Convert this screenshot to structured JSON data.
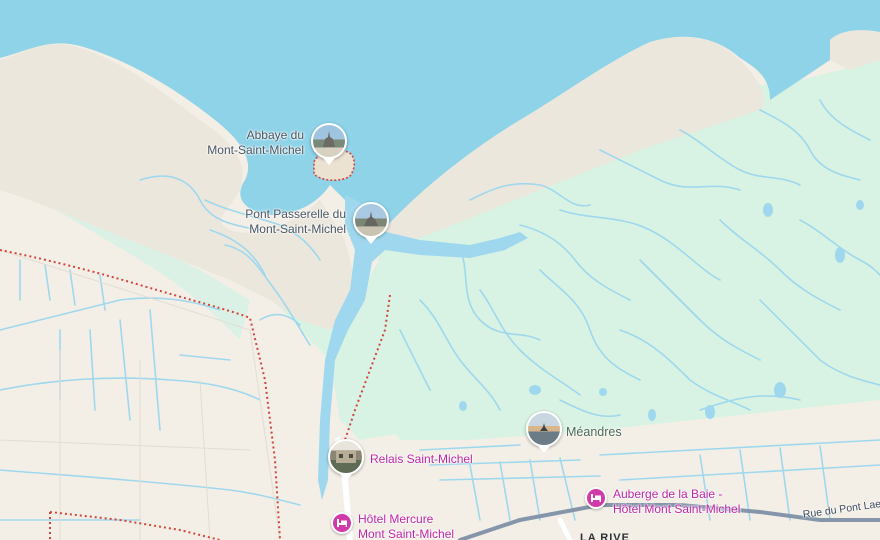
{
  "map": {
    "colors": {
      "water": "#8ed3e8",
      "sand": "#ece7dc",
      "marsh": "#d8f3e3",
      "land": "#f3efe7",
      "river": "#9fd8ee",
      "boundary": "#d2453c",
      "road": "#8596ab",
      "hotel": "#d03aa9"
    },
    "places": [
      {
        "name_line1": "Abbaye du",
        "name_line2": "Mont-Saint-Michel",
        "icon": "abbey-photo-icon"
      },
      {
        "name_line1": "Pont Passerelle du",
        "name_line2": "Mont-Saint-Michel",
        "icon": "bridge-photo-icon"
      },
      {
        "name_line1": "Méandres",
        "icon": "meandres-photo-icon"
      }
    ],
    "hotels": [
      {
        "name_line1": "Relais Saint-Michel",
        "icon": "hotel-photo-icon"
      },
      {
        "name_line1": "Hôtel Mercure",
        "name_line2": "Mont Saint-Michel",
        "icon": "bed-icon"
      },
      {
        "name_line1": "Auberge de la Baie -",
        "name_line2": "Hôtel Mont Saint-Michel",
        "icon": "bed-icon"
      }
    ],
    "roads": [
      {
        "name": "Rue du Pont Lae"
      }
    ],
    "towns": [
      {
        "name": "LA RIVE"
      }
    ]
  }
}
